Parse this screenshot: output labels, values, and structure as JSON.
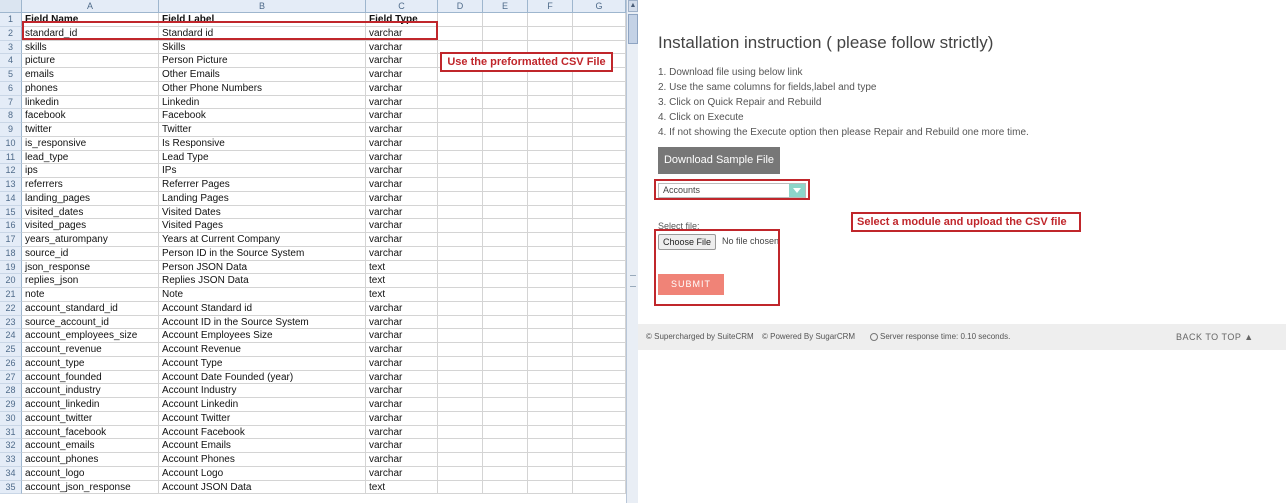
{
  "sheet": {
    "columns": [
      "A",
      "B",
      "C",
      "D",
      "E",
      "F",
      "G"
    ],
    "rows": [
      [
        "Field Name",
        "Field Label",
        "Field Type"
      ],
      [
        "standard_id",
        "Standard id",
        "varchar"
      ],
      [
        "skills",
        "Skills",
        "varchar"
      ],
      [
        "picture",
        "Person Picture",
        "varchar"
      ],
      [
        "emails",
        "Other Emails",
        "varchar"
      ],
      [
        "phones",
        "Other Phone Numbers",
        "varchar"
      ],
      [
        "linkedin",
        "Linkedin",
        "varchar"
      ],
      [
        "facebook",
        "Facebook",
        "varchar"
      ],
      [
        "twitter",
        "Twitter",
        "varchar"
      ],
      [
        "is_responsive",
        "Is Responsive",
        "varchar"
      ],
      [
        "lead_type",
        "Lead Type",
        "varchar"
      ],
      [
        "ips",
        "IPs",
        "varchar"
      ],
      [
        "referrers",
        "Referrer Pages",
        "varchar"
      ],
      [
        "landing_pages",
        "Landing Pages",
        "varchar"
      ],
      [
        "visited_dates",
        "Visited Dates",
        "varchar"
      ],
      [
        "visited_pages",
        "Visited Pages",
        "varchar"
      ],
      [
        "years_aturompany",
        "Years at Current Company",
        "varchar"
      ],
      [
        "source_id",
        "Person ID in the Source System",
        "varchar"
      ],
      [
        "json_response",
        "Person JSON Data",
        "text"
      ],
      [
        "replies_json",
        "Replies JSON Data",
        "text"
      ],
      [
        "note",
        "Note",
        "text"
      ],
      [
        "account_standard_id",
        "Account Standard id",
        "varchar"
      ],
      [
        "source_account_id",
        "Account ID in the Source System",
        "varchar"
      ],
      [
        "account_employees_size",
        "Account Employees Size",
        "varchar"
      ],
      [
        "account_revenue",
        "Account Revenue",
        "varchar"
      ],
      [
        "account_type",
        "Account Type",
        "varchar"
      ],
      [
        "account_founded",
        "Account Date Founded (year)",
        "varchar"
      ],
      [
        "account_industry",
        "Account Industry",
        "varchar"
      ],
      [
        "account_linkedin",
        "Account Linkedin",
        "varchar"
      ],
      [
        "account_twitter",
        "Account Twitter",
        "varchar"
      ],
      [
        "account_facebook",
        "Account Facebook",
        "varchar"
      ],
      [
        "account_emails",
        "Account Emails",
        "varchar"
      ],
      [
        "account_phones",
        "Account Phones",
        "varchar"
      ],
      [
        "account_logo",
        "Account Logo",
        "varchar"
      ],
      [
        "account_json_response",
        "Account JSON Data",
        "text"
      ]
    ],
    "callout": "Use the preformatted CSV File"
  },
  "crm": {
    "title": "Installation instruction ( please follow strictly)",
    "steps": [
      "1. Download file using below link",
      "2. Use the same columns for fields,label and type",
      "3. Click on Quick Repair and Rebuild",
      "4. Click on Execute",
      "4. If not showing the Execute option then please Repair and Rebuild one more time."
    ],
    "download_button": "Download Sample File",
    "module_select": "Accounts",
    "select_file_label": "Select file:",
    "choose_file_button": "Choose File",
    "no_file_text": "No file chosen",
    "submit_button": "SUBMIT",
    "callout": "Select a module and upload the CSV file",
    "footer": {
      "suitecrm": "© Supercharged by SuiteCRM",
      "sugarcrm": "© Powered By SugarCRM",
      "response": "Server response time: 0.10 seconds.",
      "back_to_top": "BACK TO TOP ▲"
    },
    "colors": {
      "accent": "#c0262b",
      "submit": "#f08377",
      "select_caret": "#8dd5c9"
    }
  }
}
